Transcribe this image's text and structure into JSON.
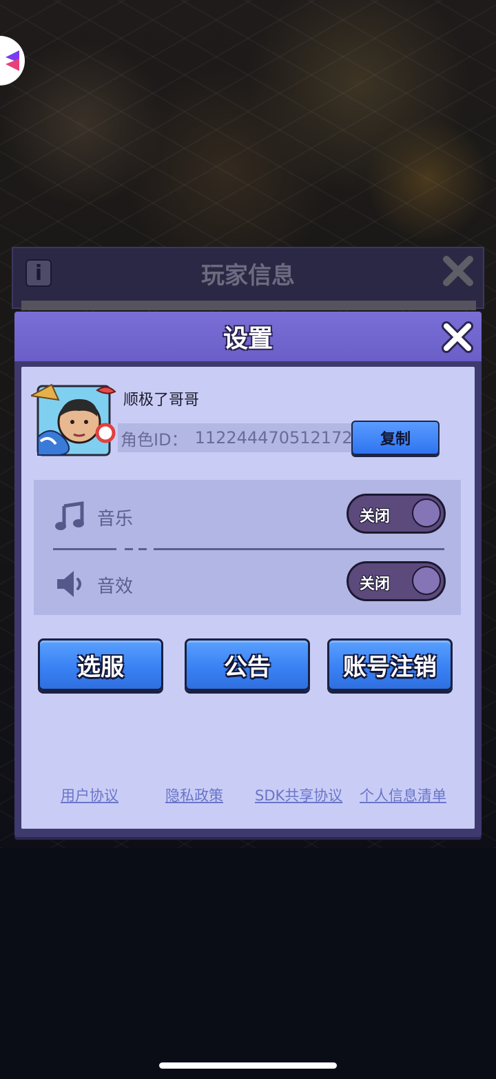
{
  "background_panel": {
    "title": "玩家信息",
    "info_icon": "i"
  },
  "settings": {
    "title": "设置",
    "profile": {
      "name": "顺极了哥哥",
      "role_id_label": "角色ID：",
      "role_id_value": "112244470512172",
      "copy_label": "复制"
    },
    "audio": {
      "music_label": "音乐",
      "music_toggle": "关闭",
      "sfx_label": "音效",
      "sfx_toggle": "关闭"
    },
    "actions": {
      "server_select": "选服",
      "notice": "公告",
      "account_cancel": "账号注销"
    },
    "links": {
      "user_agreement": "用户协议",
      "privacy_policy": "隐私政策",
      "sdk_sharing": "SDK共享协议",
      "personal_info": "个人信息清单"
    }
  },
  "icons": {
    "close": "close-icon",
    "music": "music-note-icon",
    "sound": "speaker-icon",
    "info": "info-icon",
    "logo": "app-logo-icon"
  },
  "colors": {
    "header_purple": "#6a5ec8",
    "body_lavender": "#c9cdf6",
    "button_blue": "#3a82f4",
    "toggle_off": "#5c4a7c",
    "link_blue": "#6a74c8"
  }
}
